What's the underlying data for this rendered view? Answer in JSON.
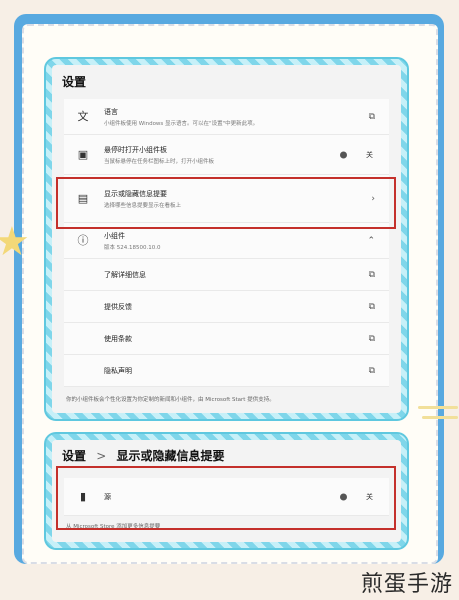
{
  "settings": {
    "title": "设置",
    "rows": [
      {
        "label": "语言",
        "desc": "小组件板使用 Windows 显示语言。可以在\"设置\"中更新此项。",
        "icon": "language-icon",
        "action": "external-link-icon"
      },
      {
        "label": "悬停时打开小组件板",
        "desc": "当鼠标悬停在任务栏图标上时，打开小组件板",
        "icon": "widget-board-icon",
        "toggle_label": "关"
      },
      {
        "label": "显示或隐藏信息提要",
        "desc": "选择哪些信息提要显示在看板上",
        "icon": "feed-icon",
        "action": "chevron-right-icon"
      },
      {
        "label": "小组件",
        "desc": "版本 524.18500.10.0",
        "icon": "info-icon",
        "action": "chevron-up-icon"
      }
    ],
    "sub_rows": [
      {
        "label": "了解详细信息",
        "action": "external-link-icon"
      },
      {
        "label": "提供反馈",
        "action": "external-link-icon"
      },
      {
        "label": "使用条款",
        "action": "external-link-icon"
      },
      {
        "label": "隐私声明",
        "action": "external-link-icon"
      }
    ],
    "footer": "你的小组件板会个性化设置为你定制的新闻和小组件，由 Microsoft Start 提供支持。"
  },
  "feeds": {
    "breadcrumb_root": "设置",
    "breadcrumb_sep": ">",
    "breadcrumb_page": "显示或隐藏信息提要",
    "source_label": "源",
    "toggle_label": "关",
    "footer": "从 Microsoft Store 添加更多信息提要"
  },
  "watermark": "煎蛋手游",
  "colors": {
    "frame": "#58a9e0",
    "highlight": "#c4302b",
    "stripe": "#7fd6ea"
  }
}
